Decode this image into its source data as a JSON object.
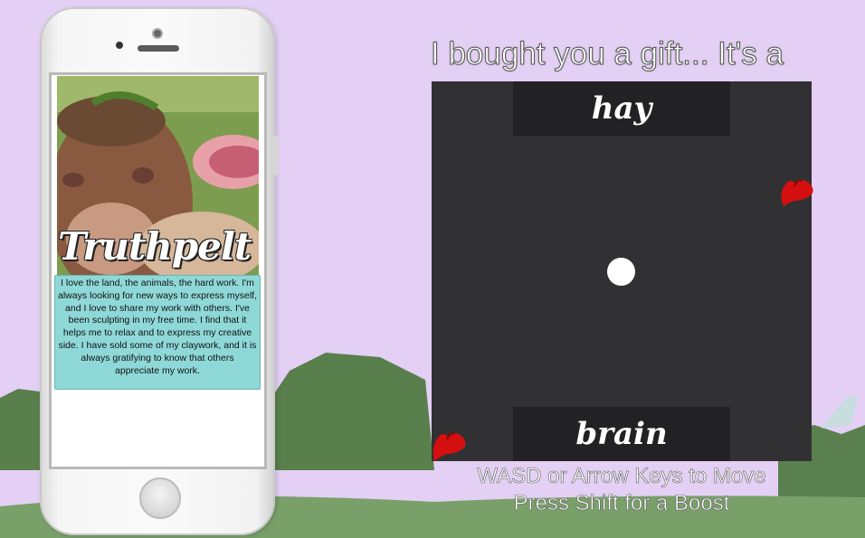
{
  "profile": {
    "name": "Truthpelt",
    "bio": "I love the land, the animals, the hard work. I'm always looking for new ways to express myself, and I love to share my work with others. I've been sculpting in my free time. I find that it helps me to relax and to express my creative side. I have sold some of my claywork, and it is always gratifying to know that others appreciate my work."
  },
  "game": {
    "title": "I bought you a gift... It's a",
    "goal_top": "hay",
    "goal_bottom": "brain",
    "instructions_line1": "WASD or Arrow Keys to Move",
    "instructions_line2": "Press Shift for a Boost"
  },
  "colors": {
    "background": "#e3d0f4",
    "arena": "#313133",
    "goal": "#222224",
    "bio_box": "#8fd8d8",
    "player_heart": "#d40f0f"
  },
  "icons": {
    "player_top": "red-heart-icon",
    "player_bottom": "red-heart-icon"
  }
}
